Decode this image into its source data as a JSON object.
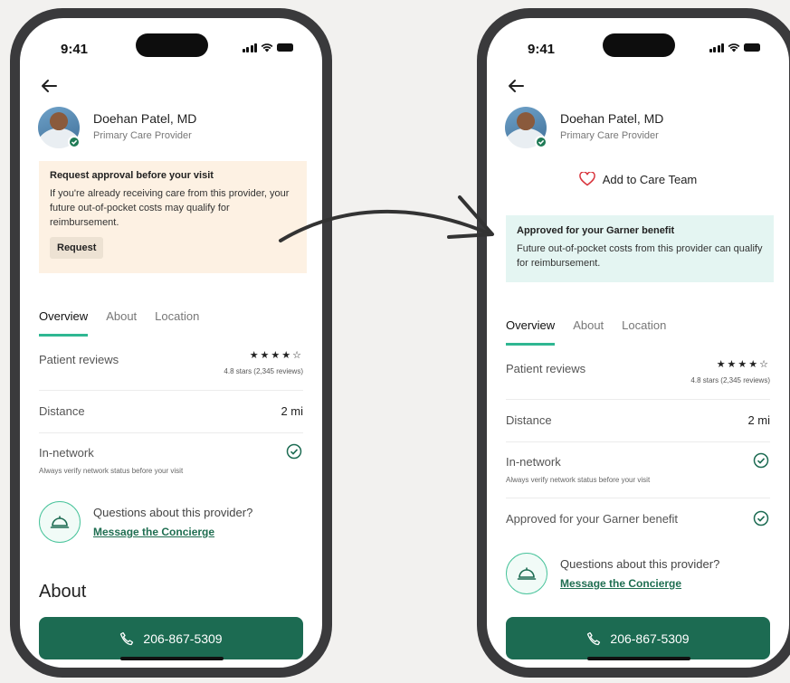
{
  "status_bar": {
    "time": "9:41"
  },
  "provider": {
    "name": "Doehan Patel, MD",
    "role": "Primary Care Provider"
  },
  "left_screen": {
    "notice": {
      "title": "Request approval before your visit",
      "body": "If you're already receiving care from this provider, your future out-of-pocket costs may qualify for reimbursement.",
      "button_label": "Request"
    },
    "tabs": [
      {
        "label": "Overview",
        "active": true
      },
      {
        "label": "About",
        "active": false
      },
      {
        "label": "Location",
        "active": false
      }
    ],
    "reviews": {
      "label": "Patient reviews",
      "stars": "★★★★☆",
      "summary": "4.8 stars (2,345 reviews)"
    },
    "distance": {
      "label": "Distance",
      "value": "2 mi"
    },
    "network": {
      "label": "In-network",
      "sub": "Always verify network status before your visit"
    },
    "concierge": {
      "question": "Questions about this provider?",
      "link": "Message the Concierge"
    },
    "about_heading": "About",
    "call_label": "206-867-5309"
  },
  "right_screen": {
    "care_team_label": "Add to Care Team",
    "notice": {
      "title": "Approved for your Garner benefit",
      "body": "Future out-of-pocket costs from this provider can qualify for reimbursement."
    },
    "tabs": [
      {
        "label": "Overview",
        "active": true
      },
      {
        "label": "About",
        "active": false
      },
      {
        "label": "Location",
        "active": false
      }
    ],
    "reviews": {
      "label": "Patient reviews",
      "stars": "★★★★☆",
      "summary": "4.8 stars (2,345 reviews)"
    },
    "distance": {
      "label": "Distance",
      "value": "2 mi"
    },
    "network": {
      "label": "In-network",
      "sub": "Always verify network status before your visit"
    },
    "benefit": {
      "label": "Approved for your Garner benefit"
    },
    "concierge": {
      "question": "Questions about this provider?",
      "link": "Message the Concierge"
    },
    "call_label": "206-867-5309"
  },
  "colors": {
    "accent_green": "#1c6b52",
    "tab_underline": "#2fb792",
    "warning_bg": "#fdf1e3",
    "success_bg": "#e4f5f2"
  },
  "icons": [
    "back-arrow-icon",
    "verified-badge-icon",
    "heart-icon",
    "check-circle-icon",
    "bell-icon",
    "phone-icon",
    "signal-icon",
    "wifi-icon",
    "battery-icon"
  ]
}
